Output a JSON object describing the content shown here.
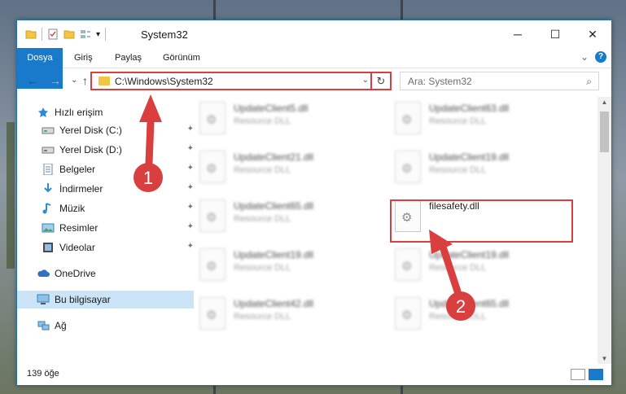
{
  "window": {
    "title": "System32",
    "controls": {
      "minimize": "─",
      "maximize": "☐",
      "close": "✕"
    }
  },
  "ribbon": {
    "tabs": [
      "Dosya",
      "Giriş",
      "Paylaş",
      "Görünüm"
    ],
    "expand": "⌄",
    "help": "?"
  },
  "nav": {
    "back": "←",
    "forward": "→",
    "recent": "⌄",
    "up": "↑",
    "address": "C:\\Windows\\System32",
    "address_dropdown": "⌄",
    "refresh": "↻",
    "search_placeholder": "Ara: System32",
    "search_icon": "⌕"
  },
  "sidebar": {
    "items": [
      {
        "label": "Hızlı erişim",
        "icon": "star-icon",
        "pinned": false
      },
      {
        "label": "Yerel Disk (C:)",
        "icon": "drive-icon",
        "pinned": true
      },
      {
        "label": "Yerel Disk (D:)",
        "icon": "drive-icon",
        "pinned": true
      },
      {
        "label": "Belgeler",
        "icon": "document-icon",
        "pinned": true
      },
      {
        "label": "İndirmeler",
        "icon": "download-icon",
        "pinned": true
      },
      {
        "label": "Müzik",
        "icon": "music-icon",
        "pinned": true
      },
      {
        "label": "Resimler",
        "icon": "pictures-icon",
        "pinned": true
      },
      {
        "label": "Videolar",
        "icon": "video-icon",
        "pinned": true
      },
      {
        "label": "OneDrive",
        "icon": "cloud-icon",
        "pinned": false
      },
      {
        "label": "Bu bilgisayar",
        "icon": "computer-icon",
        "pinned": false,
        "selected": true
      },
      {
        "label": "Ağ",
        "icon": "network-icon",
        "pinned": false
      }
    ],
    "pin_glyph": "📌"
  },
  "files": [
    {
      "name": "UpdateClient5.dll",
      "type": "Resource DLL",
      "blurred": true
    },
    {
      "name": "UpdateClient63.dll",
      "type": "Resource DLL",
      "blurred": true
    },
    {
      "name": "UpdateClient21.dll",
      "type": "Resource DLL",
      "blurred": true
    },
    {
      "name": "UpdateClient19.dll",
      "type": "Resource DLL",
      "blurred": true
    },
    {
      "name": "UpdateClient65.dll",
      "type": "Resource DLL",
      "blurred": true
    },
    {
      "name": "filesafety.dll",
      "type": "",
      "blurred": false
    },
    {
      "name": "UpdateClient19.dll",
      "type": "Resource DLL",
      "blurred": true
    },
    {
      "name": "UpdateClient19.dll",
      "type": "Resource DLL",
      "blurred": true
    },
    {
      "name": "UpdateClient42.dll",
      "type": "Resource DLL",
      "blurred": true
    },
    {
      "name": "UpdateClient65.dll",
      "type": "Resource DLL",
      "blurred": true
    }
  ],
  "status": {
    "count": "139 öğe"
  },
  "annotations": {
    "step1": "1",
    "step2": "2",
    "color": "#d93f3f"
  },
  "colors": {
    "accent": "#1979ca",
    "highlight": "#d93f3f"
  }
}
